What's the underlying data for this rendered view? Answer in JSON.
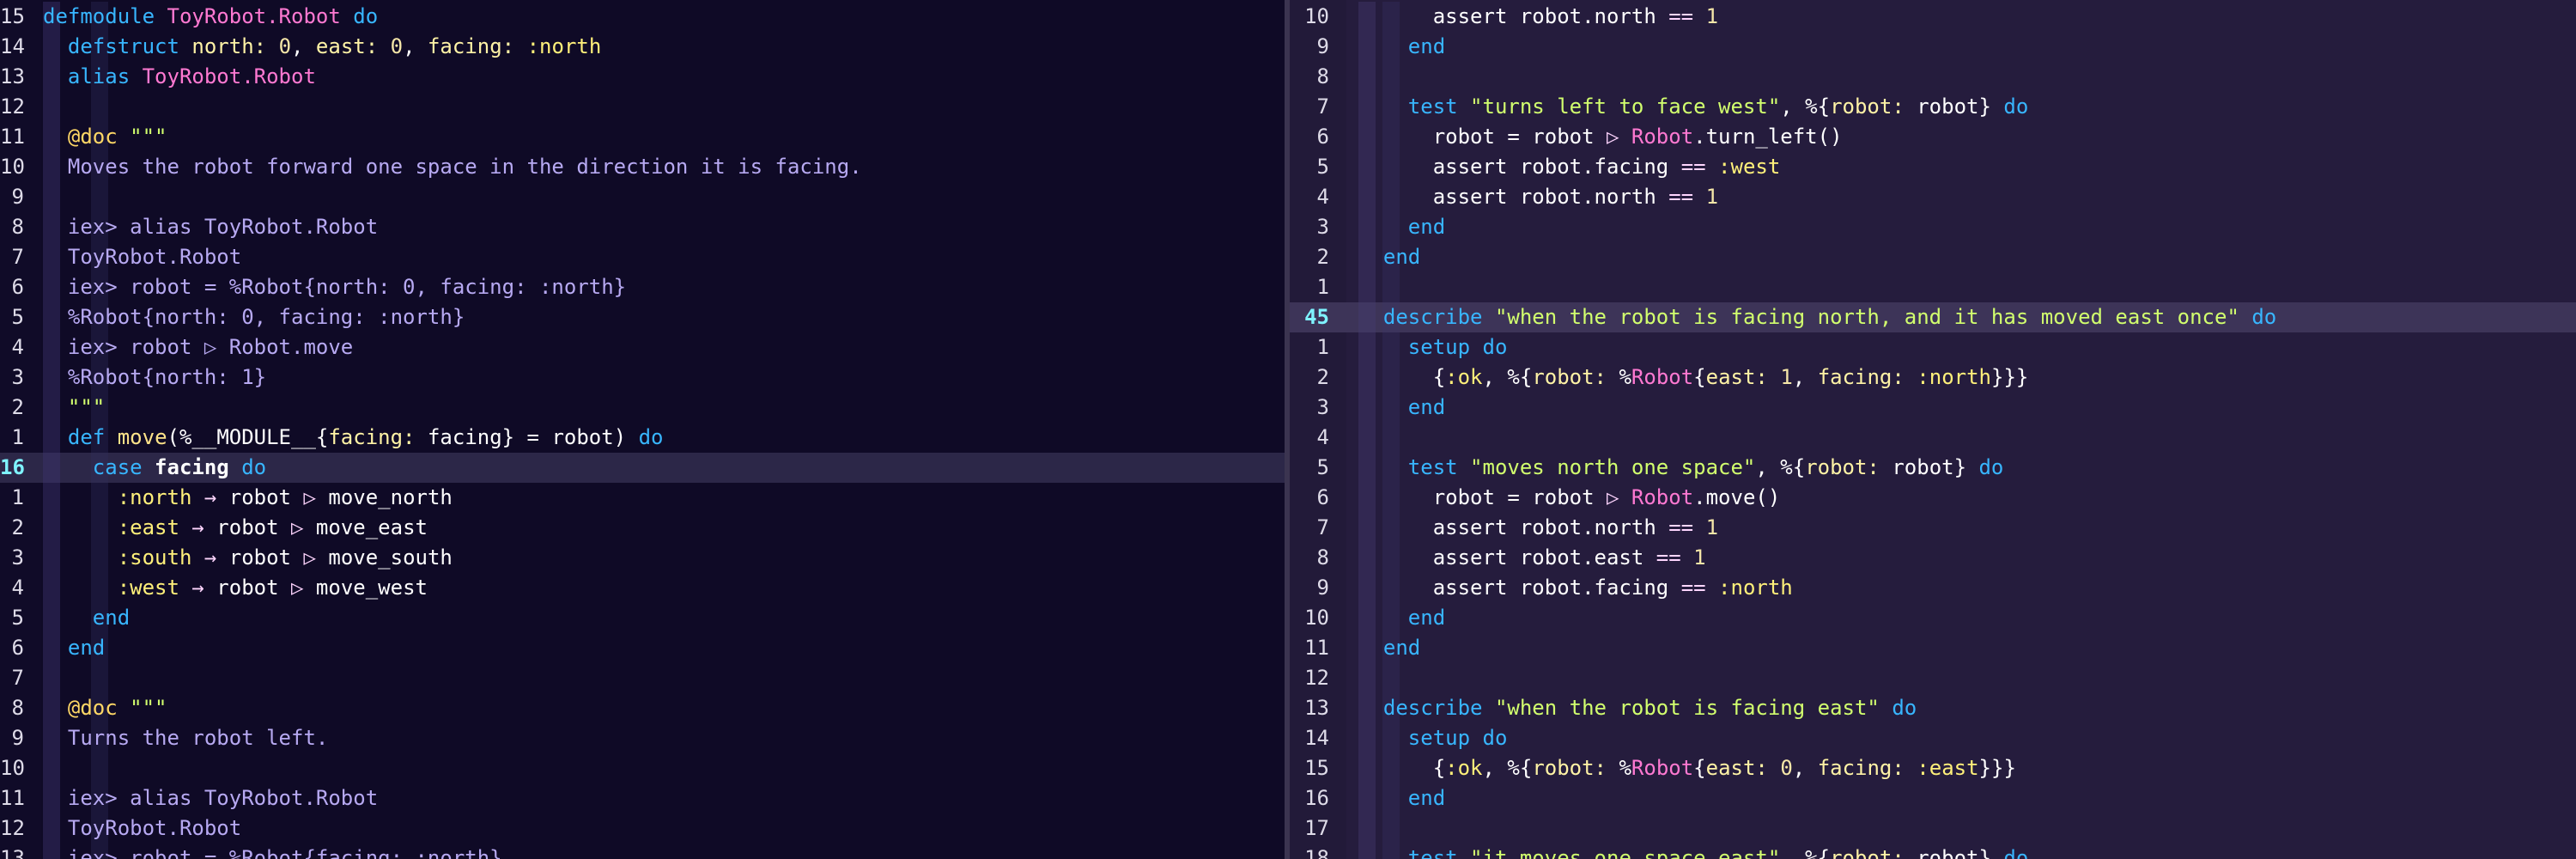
{
  "theme": {
    "kw": "#38b6ff",
    "module": "#ff79d2",
    "string": "#d2ff6e",
    "atom": "#fff07a",
    "key": "#fff3a6",
    "number": "#f5e6a8",
    "doc": "#b7a9f2",
    "attr": "#ffd866",
    "def": "#ffe48a",
    "plain": "#ffffff",
    "op": "#ffd6ff",
    "cursor_line_number": "#7ff3ff"
  },
  "left_pane": {
    "lines": [
      {
        "n": "15",
        "tokens": [
          [
            "kw",
            "defmodule"
          ],
          [
            "plain",
            " "
          ],
          [
            "mod",
            "ToyRobot.Robot"
          ],
          [
            "plain",
            " "
          ],
          [
            "kw",
            "do"
          ]
        ]
      },
      {
        "n": "14",
        "tokens": [
          [
            "plain",
            "  "
          ],
          [
            "kw",
            "defstruct"
          ],
          [
            "plain",
            " "
          ],
          [
            "key",
            "north:"
          ],
          [
            "plain",
            " "
          ],
          [
            "num",
            "0"
          ],
          [
            "plain",
            ", "
          ],
          [
            "key",
            "east:"
          ],
          [
            "plain",
            " "
          ],
          [
            "num",
            "0"
          ],
          [
            "plain",
            ", "
          ],
          [
            "key",
            "facing:"
          ],
          [
            "plain",
            " "
          ],
          [
            "atom",
            ":north"
          ]
        ]
      },
      {
        "n": "13",
        "tokens": [
          [
            "plain",
            "  "
          ],
          [
            "kw",
            "alias"
          ],
          [
            "plain",
            " "
          ],
          [
            "mod",
            "ToyRobot.Robot"
          ]
        ]
      },
      {
        "n": "12",
        "tokens": []
      },
      {
        "n": "11",
        "tokens": [
          [
            "plain",
            "  "
          ],
          [
            "attr",
            "@doc"
          ],
          [
            "plain",
            " "
          ],
          [
            "str",
            "\"\"\""
          ]
        ]
      },
      {
        "n": "10",
        "tokens": [
          [
            "plain",
            "  "
          ],
          [
            "doc",
            "Moves the robot forward one space in the direction it is facing."
          ]
        ]
      },
      {
        "n": "9",
        "tokens": []
      },
      {
        "n": "8",
        "tokens": [
          [
            "plain",
            "  "
          ],
          [
            "doc",
            "iex> alias ToyRobot.Robot"
          ]
        ]
      },
      {
        "n": "7",
        "tokens": [
          [
            "plain",
            "  "
          ],
          [
            "doc",
            "ToyRobot.Robot"
          ]
        ]
      },
      {
        "n": "6",
        "tokens": [
          [
            "plain",
            "  "
          ],
          [
            "doc",
            "iex> robot = %Robot{north: 0, facing: :north}"
          ]
        ]
      },
      {
        "n": "5",
        "tokens": [
          [
            "plain",
            "  "
          ],
          [
            "doc",
            "%Robot{north: 0, facing: :north}"
          ]
        ]
      },
      {
        "n": "4",
        "tokens": [
          [
            "plain",
            "  "
          ],
          [
            "doc",
            "iex> robot ▷ Robot.move"
          ]
        ]
      },
      {
        "n": "3",
        "tokens": [
          [
            "plain",
            "  "
          ],
          [
            "doc",
            "%Robot{north: 1}"
          ]
        ]
      },
      {
        "n": "2",
        "tokens": [
          [
            "plain",
            "  "
          ],
          [
            "str",
            "\"\"\""
          ]
        ]
      },
      {
        "n": "1",
        "tokens": [
          [
            "plain",
            "  "
          ],
          [
            "kw",
            "def"
          ],
          [
            "plain",
            " "
          ],
          [
            "def",
            "move"
          ],
          [
            "plain",
            "(%__MODULE__{"
          ],
          [
            "key",
            "facing:"
          ],
          [
            "plain",
            " facing} = robot) "
          ],
          [
            "kw",
            "do"
          ]
        ]
      },
      {
        "n": "16",
        "cursor": true,
        "tokens": [
          [
            "plain",
            "    "
          ],
          [
            "kw",
            "case"
          ],
          [
            "plain",
            " "
          ],
          [
            "bold",
            "facing"
          ],
          [
            "plain",
            " "
          ],
          [
            "kw",
            "do"
          ]
        ]
      },
      {
        "n": "1",
        "tokens": [
          [
            "plain",
            "      "
          ],
          [
            "atom",
            ":north"
          ],
          [
            "plain",
            " "
          ],
          [
            "op",
            "→"
          ],
          [
            "plain",
            " robot "
          ],
          [
            "op",
            "▷"
          ],
          [
            "plain",
            " move_north"
          ]
        ]
      },
      {
        "n": "2",
        "tokens": [
          [
            "plain",
            "      "
          ],
          [
            "atom",
            ":east"
          ],
          [
            "plain",
            " "
          ],
          [
            "op",
            "→"
          ],
          [
            "plain",
            " robot "
          ],
          [
            "op",
            "▷"
          ],
          [
            "plain",
            " move_east"
          ]
        ]
      },
      {
        "n": "3",
        "tokens": [
          [
            "plain",
            "      "
          ],
          [
            "atom",
            ":south"
          ],
          [
            "plain",
            " "
          ],
          [
            "op",
            "→"
          ],
          [
            "plain",
            " robot "
          ],
          [
            "op",
            "▷"
          ],
          [
            "plain",
            " move_south"
          ]
        ]
      },
      {
        "n": "4",
        "tokens": [
          [
            "plain",
            "      "
          ],
          [
            "atom",
            ":west"
          ],
          [
            "plain",
            " "
          ],
          [
            "op",
            "→"
          ],
          [
            "plain",
            " robot "
          ],
          [
            "op",
            "▷"
          ],
          [
            "plain",
            " move_west"
          ]
        ]
      },
      {
        "n": "5",
        "tokens": [
          [
            "plain",
            "    "
          ],
          [
            "kw",
            "end"
          ]
        ]
      },
      {
        "n": "6",
        "tokens": [
          [
            "plain",
            "  "
          ],
          [
            "kw",
            "end"
          ]
        ]
      },
      {
        "n": "7",
        "tokens": []
      },
      {
        "n": "8",
        "tokens": [
          [
            "plain",
            "  "
          ],
          [
            "attr",
            "@doc"
          ],
          [
            "plain",
            " "
          ],
          [
            "str",
            "\"\"\""
          ]
        ]
      },
      {
        "n": "9",
        "tokens": [
          [
            "plain",
            "  "
          ],
          [
            "doc",
            "Turns the robot left."
          ]
        ]
      },
      {
        "n": "10",
        "tokens": []
      },
      {
        "n": "11",
        "tokens": [
          [
            "plain",
            "  "
          ],
          [
            "doc",
            "iex> alias ToyRobot.Robot"
          ]
        ]
      },
      {
        "n": "12",
        "tokens": [
          [
            "plain",
            "  "
          ],
          [
            "doc",
            "ToyRobot.Robot"
          ]
        ]
      },
      {
        "n": "13",
        "tokens": [
          [
            "plain",
            "  "
          ],
          [
            "doc",
            "iex> robot = %Robot{facing: :north}"
          ]
        ]
      }
    ]
  },
  "right_pane": {
    "lines": [
      {
        "n": "10",
        "tokens": [
          [
            "plain",
            "      assert robot.north "
          ],
          [
            "op",
            "=="
          ],
          [
            "plain",
            " "
          ],
          [
            "num",
            "1"
          ]
        ]
      },
      {
        "n": "9",
        "tokens": [
          [
            "plain",
            "    "
          ],
          [
            "kw",
            "end"
          ]
        ]
      },
      {
        "n": "8",
        "tokens": []
      },
      {
        "n": "7",
        "tokens": [
          [
            "plain",
            "    "
          ],
          [
            "kw",
            "test"
          ],
          [
            "plain",
            " "
          ],
          [
            "str",
            "\"turns left to face west\""
          ],
          [
            "plain",
            ", %{"
          ],
          [
            "key",
            "robot:"
          ],
          [
            "plain",
            " robot} "
          ],
          [
            "kw",
            "do"
          ]
        ]
      },
      {
        "n": "6",
        "tokens": [
          [
            "plain",
            "      robot = robot "
          ],
          [
            "op",
            "▷"
          ],
          [
            "plain",
            " "
          ],
          [
            "mod",
            "Robot"
          ],
          [
            "plain",
            ".turn_left()"
          ]
        ]
      },
      {
        "n": "5",
        "tokens": [
          [
            "plain",
            "      assert robot.facing "
          ],
          [
            "op",
            "=="
          ],
          [
            "plain",
            " "
          ],
          [
            "atom",
            ":west"
          ]
        ]
      },
      {
        "n": "4",
        "tokens": [
          [
            "plain",
            "      assert robot.north "
          ],
          [
            "op",
            "=="
          ],
          [
            "plain",
            " "
          ],
          [
            "num",
            "1"
          ]
        ]
      },
      {
        "n": "3",
        "tokens": [
          [
            "plain",
            "    "
          ],
          [
            "kw",
            "end"
          ]
        ]
      },
      {
        "n": "2",
        "tokens": [
          [
            "plain",
            "  "
          ],
          [
            "kw",
            "end"
          ]
        ]
      },
      {
        "n": "1",
        "tokens": []
      },
      {
        "n": "45",
        "cursor": true,
        "tokens": [
          [
            "plain",
            "  "
          ],
          [
            "kw",
            "describe"
          ],
          [
            "plain",
            " "
          ],
          [
            "str",
            "\"when the robot is facing north, and it has moved east once\""
          ],
          [
            "plain",
            " "
          ],
          [
            "kw",
            "do"
          ]
        ]
      },
      {
        "n": "1",
        "tokens": [
          [
            "plain",
            "    "
          ],
          [
            "kw",
            "setup"
          ],
          [
            "plain",
            " "
          ],
          [
            "kw",
            "do"
          ]
        ]
      },
      {
        "n": "2",
        "tokens": [
          [
            "plain",
            "      {"
          ],
          [
            "atom",
            ":ok"
          ],
          [
            "plain",
            ", %{"
          ],
          [
            "key",
            "robot:"
          ],
          [
            "plain",
            " %"
          ],
          [
            "mod",
            "Robot"
          ],
          [
            "plain",
            "{"
          ],
          [
            "key",
            "east:"
          ],
          [
            "plain",
            " "
          ],
          [
            "num",
            "1"
          ],
          [
            "plain",
            ", "
          ],
          [
            "key",
            "facing:"
          ],
          [
            "plain",
            " "
          ],
          [
            "atom",
            ":north"
          ],
          [
            "plain",
            "}}}"
          ]
        ]
      },
      {
        "n": "3",
        "tokens": [
          [
            "plain",
            "    "
          ],
          [
            "kw",
            "end"
          ]
        ]
      },
      {
        "n": "4",
        "tokens": []
      },
      {
        "n": "5",
        "tokens": [
          [
            "plain",
            "    "
          ],
          [
            "kw",
            "test"
          ],
          [
            "plain",
            " "
          ],
          [
            "str",
            "\"moves north one space\""
          ],
          [
            "plain",
            ", %{"
          ],
          [
            "key",
            "robot:"
          ],
          [
            "plain",
            " robot} "
          ],
          [
            "kw",
            "do"
          ]
        ]
      },
      {
        "n": "6",
        "tokens": [
          [
            "plain",
            "      robot = robot "
          ],
          [
            "op",
            "▷"
          ],
          [
            "plain",
            " "
          ],
          [
            "mod",
            "Robot"
          ],
          [
            "plain",
            ".move()"
          ]
        ]
      },
      {
        "n": "7",
        "tokens": [
          [
            "plain",
            "      assert robot.north "
          ],
          [
            "op",
            "=="
          ],
          [
            "plain",
            " "
          ],
          [
            "num",
            "1"
          ]
        ]
      },
      {
        "n": "8",
        "tokens": [
          [
            "plain",
            "      assert robot.east "
          ],
          [
            "op",
            "=="
          ],
          [
            "plain",
            " "
          ],
          [
            "num",
            "1"
          ]
        ]
      },
      {
        "n": "9",
        "tokens": [
          [
            "plain",
            "      assert robot.facing "
          ],
          [
            "op",
            "=="
          ],
          [
            "plain",
            " "
          ],
          [
            "atom",
            ":north"
          ]
        ]
      },
      {
        "n": "10",
        "tokens": [
          [
            "plain",
            "    "
          ],
          [
            "kw",
            "end"
          ]
        ]
      },
      {
        "n": "11",
        "tokens": [
          [
            "plain",
            "  "
          ],
          [
            "kw",
            "end"
          ]
        ]
      },
      {
        "n": "12",
        "tokens": []
      },
      {
        "n": "13",
        "tokens": [
          [
            "plain",
            "  "
          ],
          [
            "kw",
            "describe"
          ],
          [
            "plain",
            " "
          ],
          [
            "str",
            "\"when the robot is facing east\""
          ],
          [
            "plain",
            " "
          ],
          [
            "kw",
            "do"
          ]
        ]
      },
      {
        "n": "14",
        "tokens": [
          [
            "plain",
            "    "
          ],
          [
            "kw",
            "setup"
          ],
          [
            "plain",
            " "
          ],
          [
            "kw",
            "do"
          ]
        ]
      },
      {
        "n": "15",
        "tokens": [
          [
            "plain",
            "      {"
          ],
          [
            "atom",
            ":ok"
          ],
          [
            "plain",
            ", %{"
          ],
          [
            "key",
            "robot:"
          ],
          [
            "plain",
            " %"
          ],
          [
            "mod",
            "Robot"
          ],
          [
            "plain",
            "{"
          ],
          [
            "key",
            "east:"
          ],
          [
            "plain",
            " "
          ],
          [
            "num",
            "0"
          ],
          [
            "plain",
            ", "
          ],
          [
            "key",
            "facing:"
          ],
          [
            "plain",
            " "
          ],
          [
            "atom",
            ":east"
          ],
          [
            "plain",
            "}}}"
          ]
        ]
      },
      {
        "n": "16",
        "tokens": [
          [
            "plain",
            "    "
          ],
          [
            "kw",
            "end"
          ]
        ]
      },
      {
        "n": "17",
        "tokens": []
      },
      {
        "n": "18",
        "tokens": [
          [
            "plain",
            "    "
          ],
          [
            "kw",
            "test"
          ],
          [
            "plain",
            " "
          ],
          [
            "str",
            "\"it moves one space east\""
          ],
          [
            "plain",
            ", %{"
          ],
          [
            "key",
            "robot:"
          ],
          [
            "plain",
            " robot} "
          ],
          [
            "kw",
            "do"
          ]
        ]
      }
    ]
  }
}
